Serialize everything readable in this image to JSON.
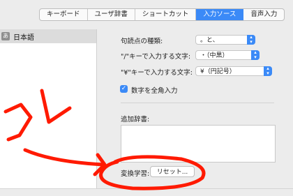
{
  "tabs": [
    {
      "label": "キーボード",
      "active": false
    },
    {
      "label": "ユーザ辞書",
      "active": false
    },
    {
      "label": "ショートカット",
      "active": false
    },
    {
      "label": "入力ソース",
      "active": true
    },
    {
      "label": "音声入力",
      "active": false
    }
  ],
  "sidebar": {
    "items": [
      {
        "icon_text": "あ",
        "label": "日本語",
        "selected": true
      }
    ]
  },
  "settings": {
    "punctuation": {
      "label": "句読点の種類:",
      "value": "。と、"
    },
    "slash_key": {
      "label": "\"/\"キーで入力する文字:",
      "value": "・（中黒）"
    },
    "yen_key": {
      "label": "\"¥\"キーで入力する文字:",
      "value": "¥（円記号）"
    },
    "fullwidth_numbers": {
      "label": "数字を全角入力",
      "checked": true
    },
    "additional_dict": {
      "label": "追加辞書:"
    },
    "conversion_learning": {
      "label": "変換学習:",
      "button": "リセット..."
    }
  },
  "annotation": {
    "text": "コレ",
    "color": "#ff1a00"
  }
}
